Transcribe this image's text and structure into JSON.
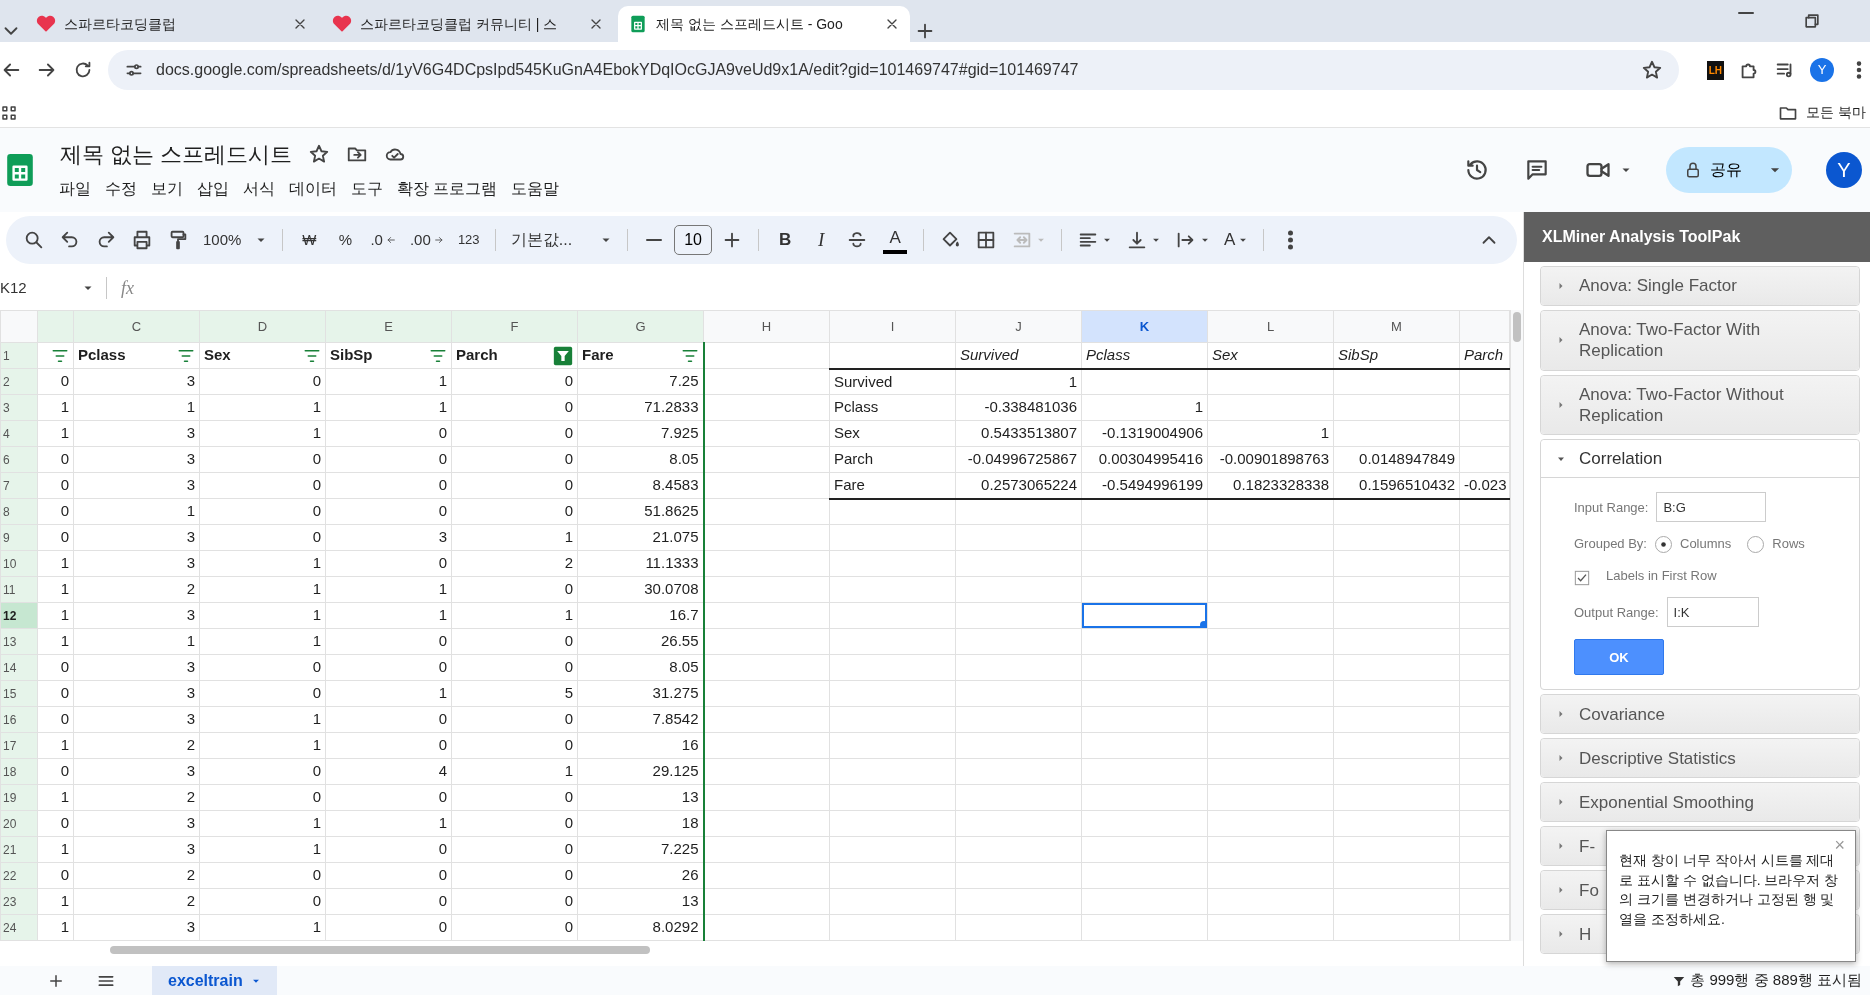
{
  "browser": {
    "tabs": [
      {
        "title": "스파르타코딩클럽",
        "selected": false
      },
      {
        "title": "스파르타코딩클럽 커뮤니티 | 스",
        "selected": false
      },
      {
        "title": "제목 없는 스프레드시트 - Goo",
        "selected": true
      }
    ],
    "address": "docs.google.com/spreadsheets/d/1yV6G4DCpsIpd545KuGnA4EbokYDqIOcGJA9veUd9x1A/edit?gid=101469747#gid=101469747",
    "extension_label": "LH",
    "profile": "Y",
    "bookmark_folder": "모든 북마"
  },
  "app": {
    "title": "제목 없는 스프레드시트",
    "menus": [
      "파일",
      "수정",
      "보기",
      "삽입",
      "서식",
      "데이터",
      "도구",
      "확장 프로그램",
      "도움말"
    ],
    "share_button": "공유",
    "avatar": "Y"
  },
  "toolbar": {
    "zoom": "100%",
    "currency": "₩",
    "percent": "%",
    "decrease_decimal": ".0",
    "increase_decimal": ".00",
    "number_format": "123",
    "font": "기본값...",
    "font_size": "10",
    "bold": "B",
    "italic": "I",
    "text_color": "A",
    "text_rotation": "A"
  },
  "formula_bar": {
    "name_box": "K12",
    "fx": "fx"
  },
  "columns": [
    {
      "label": "C",
      "selected": false
    },
    {
      "label": "D",
      "selected": false
    },
    {
      "label": "E",
      "selected": false
    },
    {
      "label": "F",
      "selected": false
    },
    {
      "label": "G",
      "selected": false
    },
    {
      "label": "H",
      "selected": false
    },
    {
      "label": "I",
      "selected": false
    },
    {
      "label": "J",
      "selected": false
    },
    {
      "label": "K",
      "selected": true
    },
    {
      "label": "L",
      "selected": false
    },
    {
      "label": "M",
      "selected": false
    }
  ],
  "filters": [
    {
      "active": false
    },
    {
      "active": false
    },
    {
      "active": false
    },
    {
      "active": false
    },
    {
      "active": true
    },
    {
      "active": false
    }
  ],
  "rows": [
    {
      "number": "1",
      "selected": false,
      "cells": [
        null,
        "Pclass",
        "Sex",
        "SibSp",
        "Parch",
        "Fare",
        null,
        null,
        "Survived",
        "Pclass",
        "Sex",
        "SibSp",
        "Parch"
      ]
    },
    {
      "number": "2",
      "selected": false,
      "cells": [
        "0",
        "3",
        "0",
        "1",
        "0",
        "7.25",
        null,
        "Survived",
        "1",
        null,
        null,
        null,
        null
      ]
    },
    {
      "number": "3",
      "selected": false,
      "cells": [
        "1",
        "1",
        "1",
        "1",
        "0",
        "71.2833",
        null,
        "Pclass",
        "-0.338481036",
        "1",
        null,
        null,
        null
      ]
    },
    {
      "number": "4",
      "selected": false,
      "cells": [
        "1",
        "3",
        "1",
        "0",
        "0",
        "7.925",
        null,
        "Sex",
        "0.5433513807",
        "-0.1319004906",
        "1",
        null,
        null
      ]
    },
    {
      "number": "6",
      "selected": false,
      "cells": [
        "0",
        "3",
        "0",
        "0",
        "0",
        "8.05",
        null,
        "Parch",
        "-0.04996725867",
        "0.00304995416",
        "-0.00901898763",
        "0.0148947849",
        null
      ]
    },
    {
      "number": "7",
      "selected": false,
      "cells": [
        "0",
        "3",
        "0",
        "0",
        "0",
        "8.4583",
        null,
        "Fare",
        "0.2573065224",
        "-0.5494996199",
        "0.1823328338",
        "0.1596510432",
        "-0.023"
      ]
    },
    {
      "number": "8",
      "selected": false,
      "cells": [
        "0",
        "1",
        "0",
        "0",
        "0",
        "51.8625",
        null,
        null,
        null,
        null,
        null,
        null,
        null
      ]
    },
    {
      "number": "9",
      "selected": false,
      "cells": [
        "0",
        "3",
        "0",
        "3",
        "1",
        "21.075",
        null,
        null,
        null,
        null,
        null,
        null,
        null
      ]
    },
    {
      "number": "10",
      "selected": false,
      "cells": [
        "1",
        "3",
        "1",
        "0",
        "2",
        "11.1333",
        null,
        null,
        null,
        null,
        null,
        null,
        null
      ]
    },
    {
      "number": "11",
      "selected": false,
      "cells": [
        "1",
        "2",
        "1",
        "1",
        "0",
        "30.0708",
        null,
        null,
        null,
        null,
        null,
        null,
        null
      ]
    },
    {
      "number": "12",
      "selected": true,
      "cells": [
        "1",
        "3",
        "1",
        "1",
        "1",
        "16.7",
        null,
        null,
        null,
        null,
        null,
        null,
        null
      ]
    },
    {
      "number": "13",
      "selected": false,
      "cells": [
        "1",
        "1",
        "1",
        "0",
        "0",
        "26.55",
        null,
        null,
        null,
        null,
        null,
        null,
        null
      ]
    },
    {
      "number": "14",
      "selected": false,
      "cells": [
        "0",
        "3",
        "0",
        "0",
        "0",
        "8.05",
        null,
        null,
        null,
        null,
        null,
        null,
        null
      ]
    },
    {
      "number": "15",
      "selected": false,
      "cells": [
        "0",
        "3",
        "0",
        "1",
        "5",
        "31.275",
        null,
        null,
        null,
        null,
        null,
        null,
        null
      ]
    },
    {
      "number": "16",
      "selected": false,
      "cells": [
        "0",
        "3",
        "1",
        "0",
        "0",
        "7.8542",
        null,
        null,
        null,
        null,
        null,
        null,
        null
      ]
    },
    {
      "number": "17",
      "selected": false,
      "cells": [
        "1",
        "2",
        "1",
        "0",
        "0",
        "16",
        null,
        null,
        null,
        null,
        null,
        null,
        null
      ]
    },
    {
      "number": "18",
      "selected": false,
      "cells": [
        "0",
        "3",
        "0",
        "4",
        "1",
        "29.125",
        null,
        null,
        null,
        null,
        null,
        null,
        null
      ]
    },
    {
      "number": "19",
      "selected": false,
      "cells": [
        "1",
        "2",
        "0",
        "0",
        "0",
        "13",
        null,
        null,
        null,
        null,
        null,
        null,
        null
      ]
    },
    {
      "number": "20",
      "selected": false,
      "cells": [
        "0",
        "3",
        "1",
        "1",
        "0",
        "18",
        null,
        null,
        null,
        null,
        null,
        null,
        null
      ]
    },
    {
      "number": "21",
      "selected": false,
      "cells": [
        "1",
        "3",
        "1",
        "0",
        "0",
        "7.225",
        null,
        null,
        null,
        null,
        null,
        null,
        null
      ]
    },
    {
      "number": "22",
      "selected": false,
      "cells": [
        "0",
        "2",
        "0",
        "0",
        "0",
        "26",
        null,
        null,
        null,
        null,
        null,
        null,
        null
      ]
    },
    {
      "number": "23",
      "selected": false,
      "cells": [
        "1",
        "2",
        "0",
        "0",
        "0",
        "13",
        null,
        null,
        null,
        null,
        null,
        null,
        null
      ]
    },
    {
      "number": "24",
      "selected": false,
      "cells": [
        "1",
        "3",
        "1",
        "0",
        "0",
        "8.0292",
        null,
        null,
        null,
        null,
        null,
        null,
        null
      ]
    }
  ],
  "side_panel": {
    "title": "XLMiner Analysis ToolPak",
    "sections": [
      {
        "title": "Anova: Single Factor",
        "expanded": false
      },
      {
        "title": "Anova: Two-Factor With Replication",
        "expanded": false
      },
      {
        "title": "Anova: Two-Factor Without Replication",
        "expanded": false
      },
      {
        "title": "Correlation",
        "expanded": true
      },
      {
        "title": "Covariance",
        "expanded": false
      },
      {
        "title": "Descriptive Statistics",
        "expanded": false
      },
      {
        "title": "Exponential Smoothing",
        "expanded": false
      },
      {
        "title": "F-",
        "expanded": false
      },
      {
        "title": "Fo",
        "expanded": false
      },
      {
        "title": "H",
        "expanded": false
      }
    ],
    "form": {
      "input_label": "Input Range:",
      "input_value": "B:G",
      "grouped_label": "Grouped By:",
      "options": [
        {
          "label": "Columns",
          "selected": true
        },
        {
          "label": "Rows",
          "selected": false
        }
      ],
      "checkbox": {
        "label": "Labels in First Row",
        "checked": true
      },
      "output_label": "Output Range:",
      "output_value": "I:K",
      "button": "OK"
    }
  },
  "popup": {
    "close": "×",
    "text": "현재 창이 너무 작아서 시트를 제대로 표시할 수 없습니다. 브라우저 창의 크기를 변경하거나 고정된 행 및 열을 조정하세요."
  },
  "sheet_tabs": [
    {
      "name": "exceltrain",
      "selected": true
    }
  ],
  "status": "총 999행 중 889행 표시됨"
}
